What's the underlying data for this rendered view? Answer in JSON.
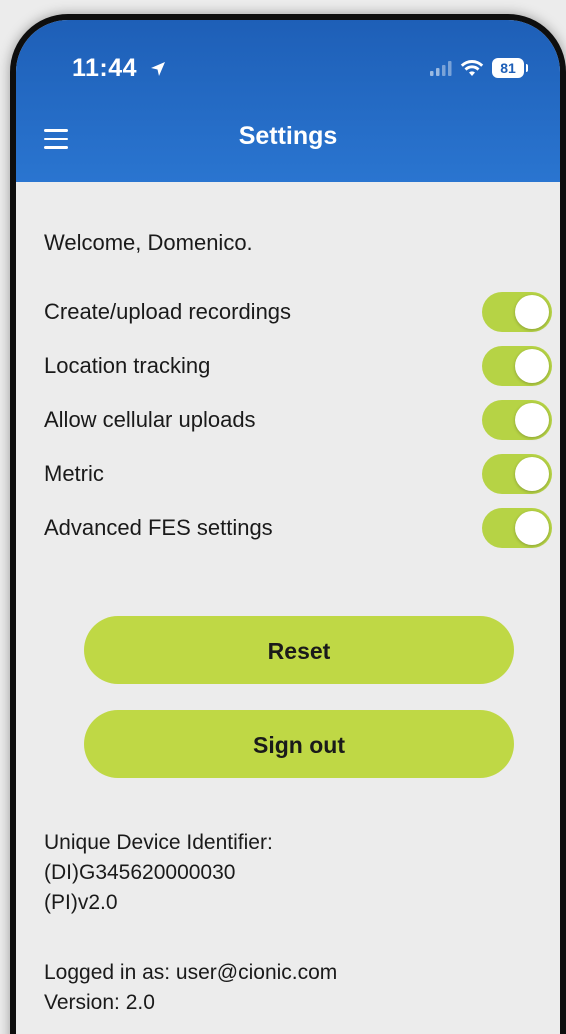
{
  "status_bar": {
    "time": "11:44",
    "battery": "81"
  },
  "header": {
    "title": "Settings"
  },
  "welcome": "Welcome, Domenico.",
  "toggles": [
    {
      "label": "Create/upload recordings",
      "on": true
    },
    {
      "label": "Location tracking",
      "on": true
    },
    {
      "label": "Allow cellular uploads",
      "on": true
    },
    {
      "label": "Metric",
      "on": true
    },
    {
      "label": "Advanced FES settings",
      "on": true
    }
  ],
  "buttons": {
    "reset": "Reset",
    "sign_out": "Sign out"
  },
  "device_info": {
    "udi_label": "Unique Device Identifier:",
    "di": "(DI)G345620000030",
    "pi": "(PI)v2.0"
  },
  "account": {
    "logged_in": "Logged in as: user@cionic.com",
    "version": "Version: 2.0"
  },
  "colors": {
    "header_blue": "#2a75d0",
    "accent_green": "#bfd845",
    "background": "#ececec"
  }
}
